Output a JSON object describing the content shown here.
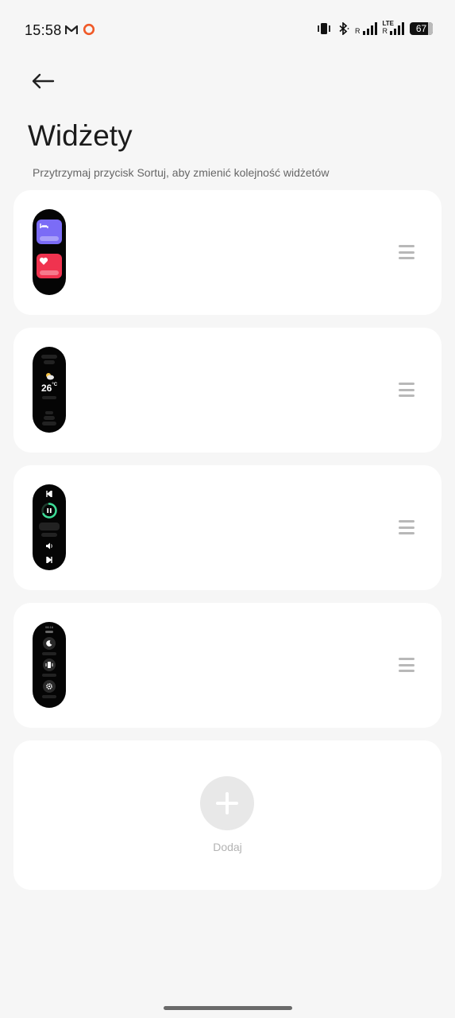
{
  "status_bar": {
    "time": "15:58",
    "battery": "67",
    "signal_r1": "R",
    "signal_r2": "R",
    "lte": "LTE"
  },
  "header": {
    "back_icon": "arrow-left-icon",
    "title": "Widżety",
    "subtitle": "Przytrzymaj przycisk Sortuj, aby zmienić kolejność widżetów"
  },
  "widgets": [
    {
      "id": "sleep-heart",
      "tiles": [
        {
          "icon": "bed-icon",
          "color": "#7b6cf6"
        },
        {
          "icon": "heart-icon",
          "color": "#f0334f"
        }
      ]
    },
    {
      "id": "weather",
      "temperature": "26",
      "unit": "°C"
    },
    {
      "id": "music",
      "accent": "#3ddc97"
    },
    {
      "id": "shortcuts",
      "time_text": "08:16",
      "icons": [
        "moon-icon",
        "vibrate-icon",
        "gear-icon"
      ]
    }
  ],
  "add": {
    "label": "Dodaj"
  },
  "colors": {
    "background": "#f6f6f6",
    "card": "#ffffff",
    "handle": "#b8b8b8"
  }
}
